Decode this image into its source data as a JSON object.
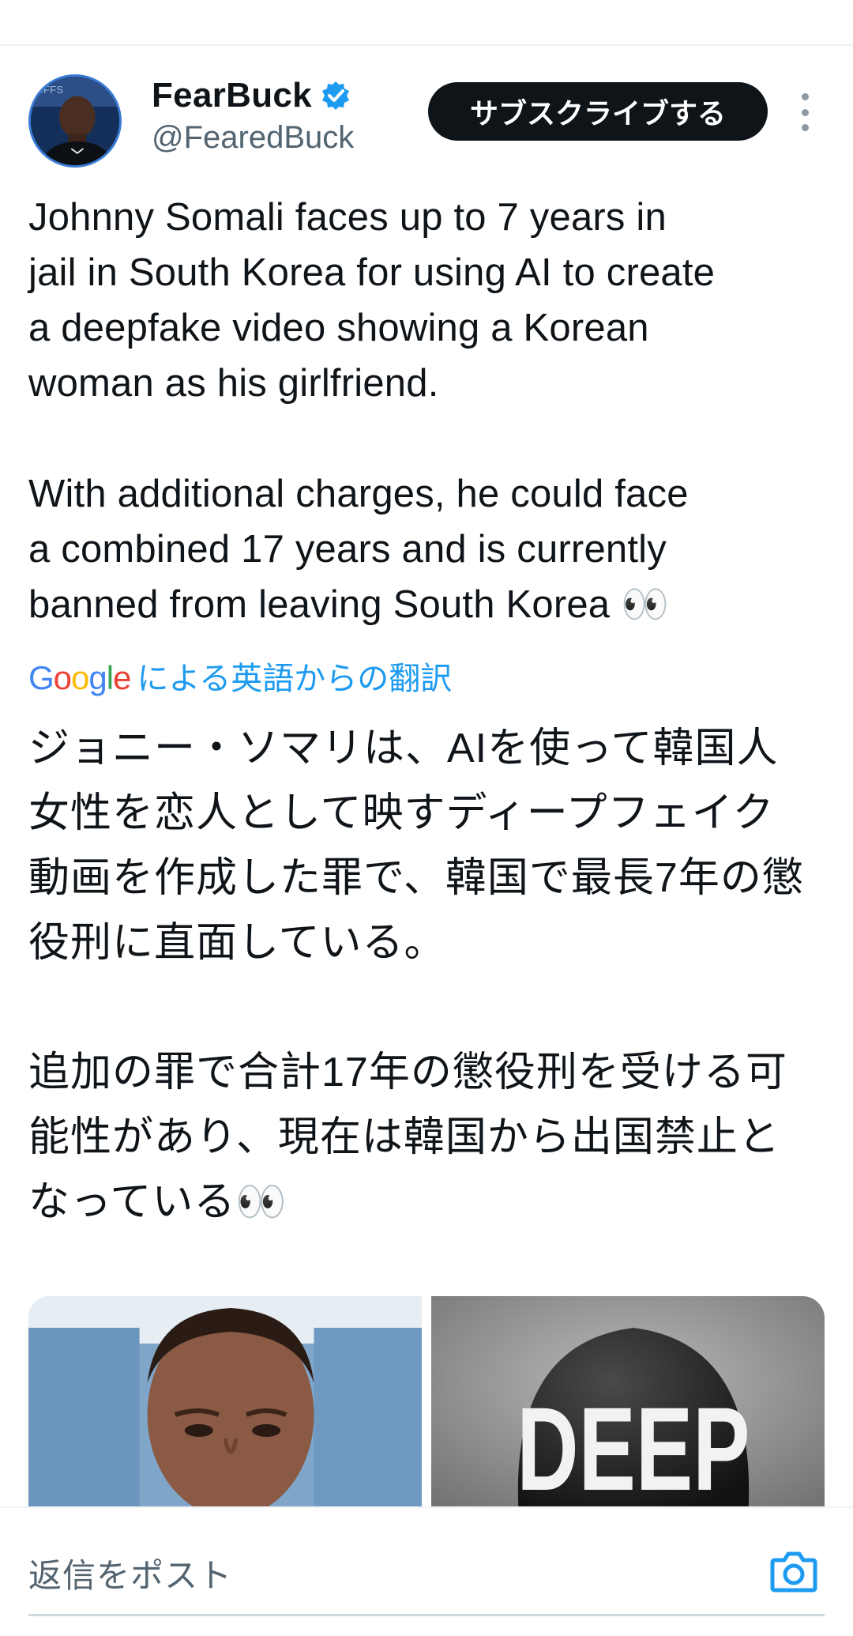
{
  "header": {
    "display_name": "FearBuck",
    "handle": "@FearedBuck",
    "subscribe_label": "サブスクライブする"
  },
  "tweet": {
    "text": "Johnny Somali faces up to 7 years in\njail in South Korea for using AI to create\na deepfake video showing a Korean\nwoman as his girlfriend.\n\nWith additional charges, he could face\na combined 17 years and is currently\nbanned from leaving South Korea 👀",
    "translation": {
      "provider_logo": "Google",
      "label": "による英語からの翻訳",
      "text": "ジョニー・ソマリは、AIを使って韓国人\n女性を恋人として映すディープフェイク\n動画を作成した罪で、韓国で最長7年の懲\n役刑に直面している。\n\n追加の罪で合計17年の懲役刑を受ける可\n能性があり、現在は韓国から出国禁止と\nなっている👀"
    },
    "media": [
      {
        "name": "photo-man"
      },
      {
        "name": "photo-deep-helmet",
        "visible_text": "DEEP"
      }
    ]
  },
  "reply": {
    "placeholder": "返信をポスト"
  },
  "colors": {
    "accent": "#1d9bf0",
    "button_bg": "#0f1419",
    "text_primary": "#0f1419",
    "text_secondary": "#536471"
  },
  "icons": [
    "verified-badge-icon",
    "more-options-icon",
    "camera-icon"
  ]
}
